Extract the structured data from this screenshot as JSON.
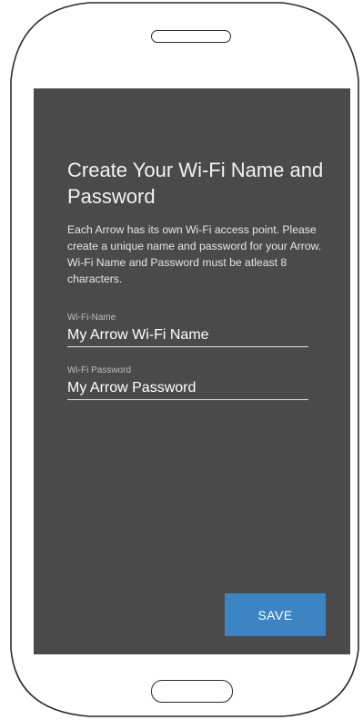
{
  "device": {
    "frame_color": "#2a2a2a",
    "screen_color": "#4a4a4b"
  },
  "icons": {
    "speaker": "speaker-slot-icon",
    "home": "home-button-icon"
  },
  "setup": {
    "title": "Create Your Wi-Fi Name and Password",
    "description": "Each Arrow has its own Wi-Fi access point. Please create a unique name and password for your Arrow. Wi-Fi Name and Password must be atleast 8 characters.",
    "wifi_name": {
      "label": "Wi-Fi-Name",
      "value": "My Arrow Wi-Fi Name"
    },
    "wifi_password": {
      "label": "Wi-Fi Password",
      "value": "My Arrow Password"
    },
    "save_label": "SAVE",
    "accent": "#3c85c4"
  }
}
